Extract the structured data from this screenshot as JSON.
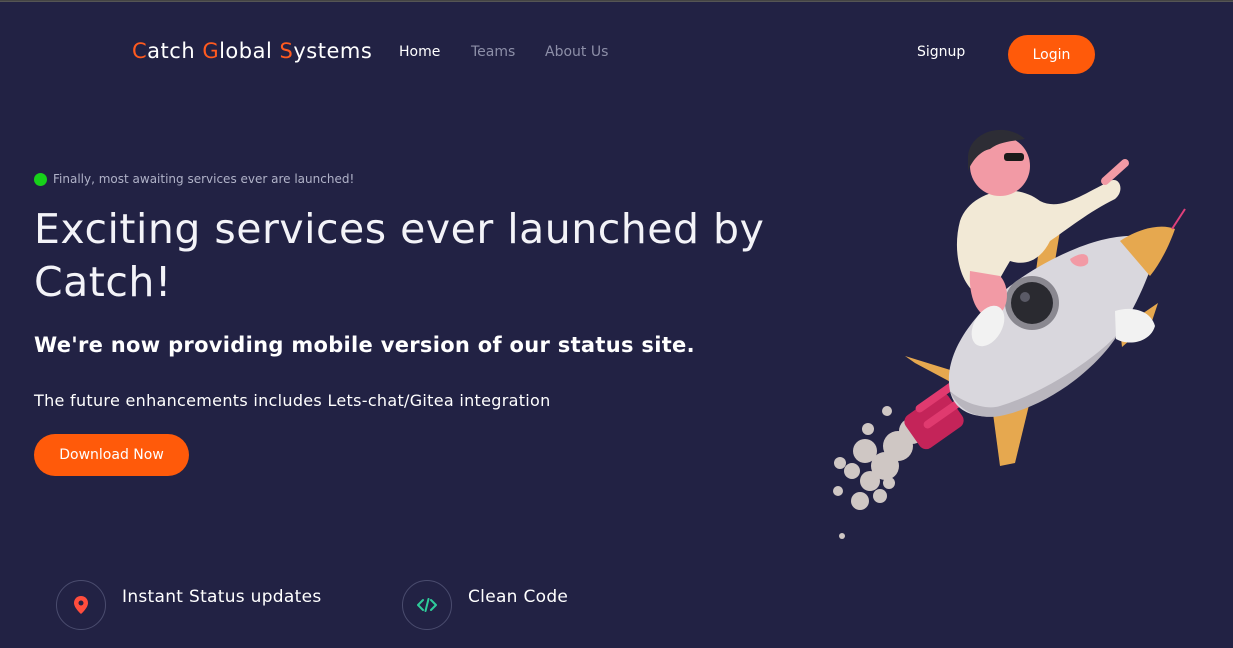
{
  "nav": {
    "brand": {
      "c1": "C",
      "r1": "atch ",
      "c2": "G",
      "r2": "lobal ",
      "c3": "S",
      "r3": "ystems"
    },
    "links": [
      "Home",
      "Teams",
      "About Us"
    ],
    "signup": "Signup",
    "login": "Login"
  },
  "hero": {
    "announcement": "Finally, most awaiting services ever are launched!",
    "title": "Exciting services ever launched by Catch!",
    "subtitle": "We're now providing mobile version of our status site.",
    "subtitle2": "The future enhancements includes Lets-chat/Gitea integration",
    "cta": "Download Now"
  },
  "features": [
    {
      "icon": "location-pin-icon",
      "label": "Instant Status updates"
    },
    {
      "icon": "code-icon",
      "label": "Clean Code"
    }
  ],
  "colors": {
    "background": "#222244",
    "accent": "#ff5a0a",
    "status_dot": "#17d11a",
    "code_icon": "#2ecc9a"
  }
}
